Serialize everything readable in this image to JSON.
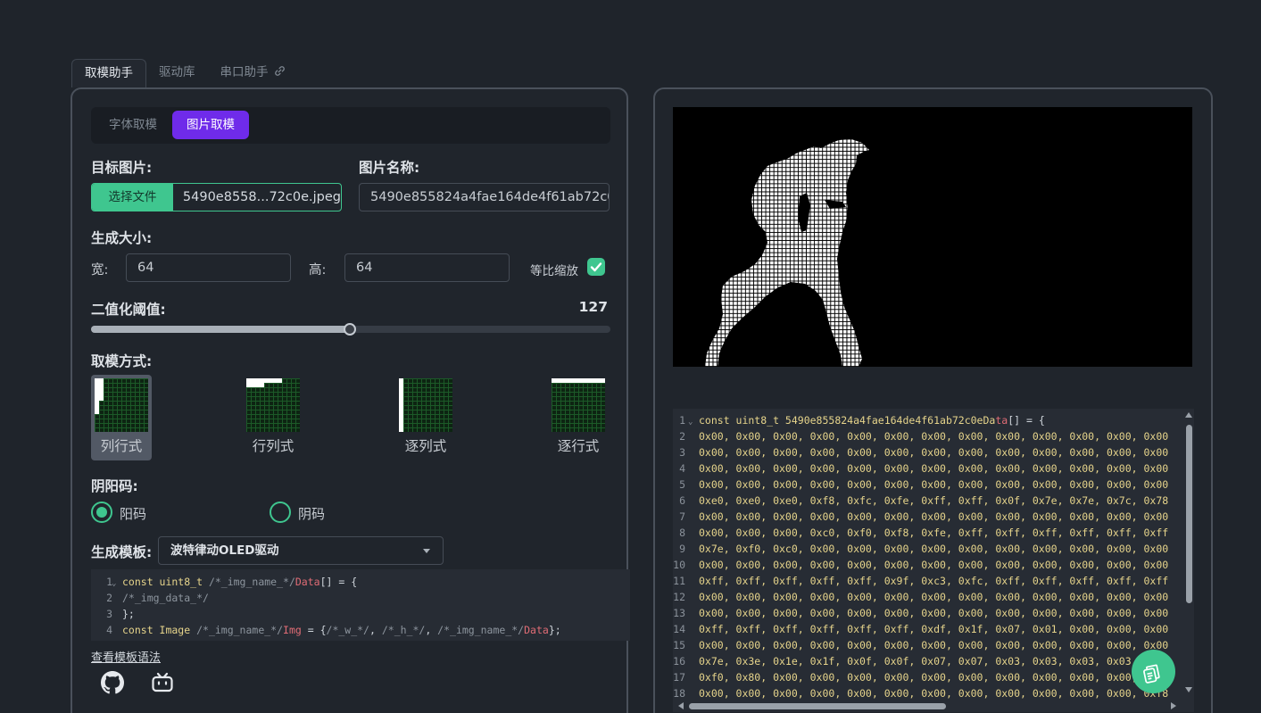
{
  "top_tabs": [
    {
      "label": "取模助手",
      "active": true
    },
    {
      "label": "驱动库",
      "active": false
    },
    {
      "label": "串口助手",
      "active": false
    }
  ],
  "mode_tabs": [
    {
      "label": "字体取模",
      "active": false
    },
    {
      "label": "图片取模",
      "active": true
    }
  ],
  "target_image": {
    "label": "目标图片:",
    "button_label": "选择文件",
    "file_name": "5490e8558...72c0e.jpeg"
  },
  "image_name": {
    "label": "图片名称:",
    "value": "5490e855824a4fae164de4f61ab72c0e"
  },
  "size": {
    "label": "生成大小:",
    "width_label": "宽:",
    "width_value": "64",
    "height_label": "高:",
    "height_value": "64",
    "keep_ratio_label": "等比缩放",
    "keep_ratio_checked": true
  },
  "threshold": {
    "label": "二值化阈值:",
    "value": "127",
    "max": 255
  },
  "scan_mode": {
    "label": "取模方式:",
    "options": [
      {
        "label": "列行式",
        "selected": true
      },
      {
        "label": "行列式",
        "selected": false
      },
      {
        "label": "逐列式",
        "selected": false
      },
      {
        "label": "逐行式",
        "selected": false
      }
    ]
  },
  "polarity": {
    "label": "阴阳码:",
    "options": [
      {
        "label": "阳码",
        "selected": true
      },
      {
        "label": "阴码",
        "selected": false
      }
    ]
  },
  "template": {
    "label": "生成模板:",
    "selected": "波特律动OLED驱动",
    "lines": [
      {
        "no": "1",
        "fold": true,
        "parts": [
          [
            "kw",
            "const uint8_t "
          ],
          [
            "cm",
            "/*_img_name_*/"
          ],
          [
            "hl",
            "Data"
          ],
          [
            "tx",
            "[] = {"
          ]
        ]
      },
      {
        "no": "2",
        "fold": false,
        "parts": [
          [
            "cm",
            "/*_img_data_*/"
          ]
        ]
      },
      {
        "no": "3",
        "fold": false,
        "parts": [
          [
            "tx",
            "};"
          ]
        ]
      },
      {
        "no": "4",
        "fold": false,
        "parts": [
          [
            "kw",
            "const Image "
          ],
          [
            "cm",
            "/*_img_name_*/"
          ],
          [
            "hl",
            "Img"
          ],
          [
            "tx",
            " = {"
          ],
          [
            "cm",
            "/*_w_*/"
          ],
          [
            "tx",
            ", "
          ],
          [
            "cm",
            "/*_h_*/"
          ],
          [
            "tx",
            ", "
          ],
          [
            "cm",
            "/*_img_name_*/"
          ],
          [
            "hl",
            "Data"
          ],
          [
            "tx",
            "};"
          ]
        ]
      }
    ],
    "syntax_link": "查看模板语法"
  },
  "social": [
    {
      "name": "github-icon"
    },
    {
      "name": "bilibili-icon"
    }
  ],
  "output_code": {
    "first_line": {
      "no": "1",
      "parts": [
        [
          "kw",
          "const uint8_t 5490e855824a4fae164de4f61ab72c0eDa"
        ],
        [
          "hl",
          "ta"
        ],
        [
          "tx",
          "[] = {"
        ]
      ]
    },
    "rows": [
      {
        "no": "2",
        "text": "0x00, 0x00, 0x00, 0x00, 0x00, 0x00, 0x00, 0x00, 0x00, 0x00, 0x00, 0x00, 0x00"
      },
      {
        "no": "3",
        "text": "0x00, 0x00, 0x00, 0x00, 0x00, 0x00, 0x00, 0x00, 0x00, 0x00, 0x00, 0x00, 0x00"
      },
      {
        "no": "4",
        "text": "0x00, 0x00, 0x00, 0x00, 0x00, 0x00, 0x00, 0x00, 0x00, 0x00, 0x00, 0x00, 0x00"
      },
      {
        "no": "5",
        "text": "0x00, 0x00, 0x00, 0x00, 0x00, 0x00, 0x00, 0x00, 0x00, 0x00, 0x00, 0x00, 0x00"
      },
      {
        "no": "6",
        "text": "0xe0, 0xe0, 0xe0, 0xf8, 0xfc, 0xfe, 0xff, 0xff, 0x0f, 0x7e, 0x7e, 0x7c, 0x78"
      },
      {
        "no": "7",
        "text": "0x00, 0x00, 0x00, 0x00, 0x00, 0x00, 0x00, 0x00, 0x00, 0x00, 0x00, 0x00, 0x00"
      },
      {
        "no": "8",
        "text": "0x00, 0x00, 0x00, 0xc0, 0xf0, 0xf8, 0xfe, 0xff, 0xff, 0xff, 0xff, 0xff, 0xff"
      },
      {
        "no": "9",
        "text": "0x7e, 0xf0, 0xc0, 0x00, 0x00, 0x00, 0x00, 0x00, 0x00, 0x00, 0x00, 0x00, 0x00"
      },
      {
        "no": "10",
        "text": "0x00, 0x00, 0x00, 0x00, 0x00, 0x00, 0x00, 0x00, 0x00, 0x00, 0x00, 0x00, 0x00"
      },
      {
        "no": "11",
        "text": "0xff, 0xff, 0xff, 0xff, 0xff, 0x9f, 0xc3, 0xfc, 0xff, 0xff, 0xff, 0xff, 0xff"
      },
      {
        "no": "12",
        "text": "0x00, 0x00, 0x00, 0x00, 0x00, 0x00, 0x00, 0x00, 0x00, 0x00, 0x00, 0x00, 0x00"
      },
      {
        "no": "13",
        "text": "0x00, 0x00, 0x00, 0x00, 0x00, 0x00, 0x00, 0x00, 0x00, 0x00, 0x00, 0x00, 0x00"
      },
      {
        "no": "14",
        "text": "0xff, 0xff, 0xff, 0xff, 0xff, 0xff, 0xdf, 0x1f, 0x07, 0x01, 0x00, 0x00, 0x00"
      },
      {
        "no": "15",
        "text": "0x00, 0x00, 0x00, 0x00, 0x00, 0x00, 0x00, 0x00, 0x00, 0x00, 0x00, 0x00, 0x00"
      },
      {
        "no": "16",
        "text": "0x7e, 0x3e, 0x1e, 0x1f, 0x0f, 0x0f, 0x07, 0x07, 0x03, 0x03, 0x03, 0x03, 0x03"
      },
      {
        "no": "17",
        "text": "0xf0, 0x80, 0x00, 0x00, 0x00, 0x00, 0x00, 0x00, 0x00, 0x00, 0x00, 0x00, 0x00"
      },
      {
        "no": "18",
        "text": "0x00, 0x00, 0x00, 0x00, 0x00, 0x00, 0x00, 0x00, 0x00, 0x00, 0x00, 0x00, 0xf8"
      }
    ]
  },
  "colors": {
    "accent_green": "#3fc68f",
    "accent_purple": "#6f2bea",
    "background": "#1f242b",
    "panel_border": "#4a515b"
  },
  "fab": {
    "icon": "copy-icon"
  }
}
